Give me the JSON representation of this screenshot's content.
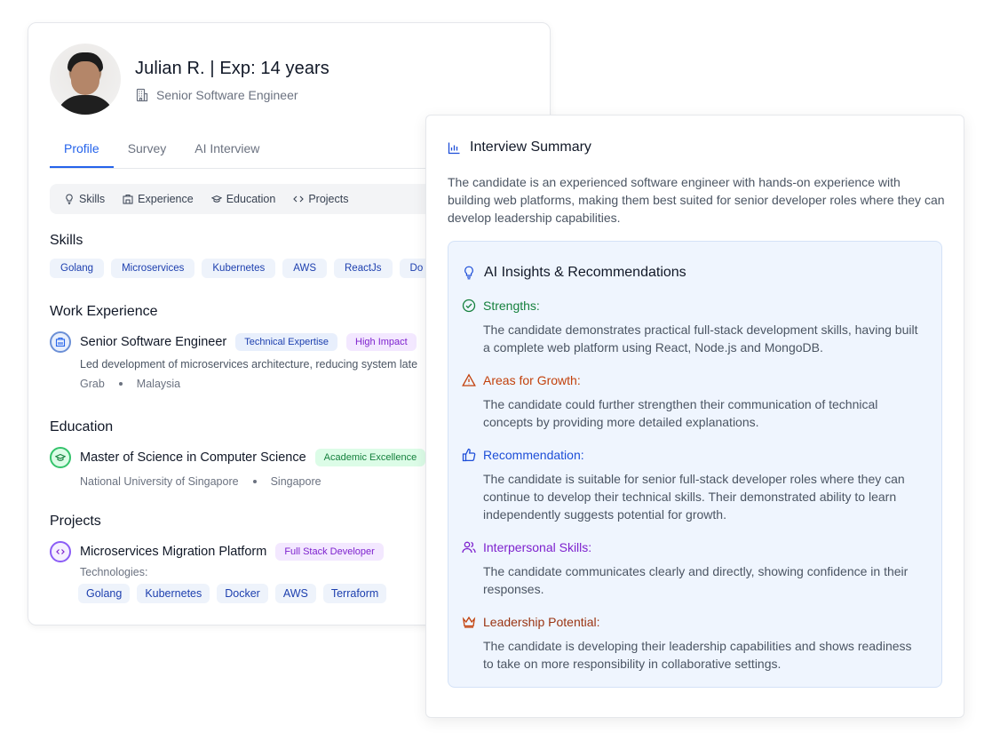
{
  "profile": {
    "name": "Julian R. | Exp: 14 years",
    "role": "Senior Software Engineer",
    "tabs": [
      {
        "label": "Profile",
        "active": true
      },
      {
        "label": "Survey",
        "active": false
      },
      {
        "label": "AI Interview",
        "active": false
      }
    ],
    "subnav": [
      {
        "label": "Skills",
        "icon": "lightbulb-icon"
      },
      {
        "label": "Experience",
        "icon": "building-icon"
      },
      {
        "label": "Education",
        "icon": "graduation-cap-icon"
      },
      {
        "label": "Projects",
        "icon": "code-icon"
      }
    ],
    "skills": {
      "title": "Skills",
      "items": [
        "Golang",
        "Microservices",
        "Kubernetes",
        "AWS",
        "ReactJs",
        "Do"
      ]
    },
    "work": {
      "title": "Work Experience",
      "entry_title": "Senior Software Engineer",
      "badges": [
        "Technical Expertise",
        "High Impact"
      ],
      "description": "Led development of microservices architecture, reducing system late",
      "company": "Grab",
      "location": "Malaysia"
    },
    "education": {
      "title": "Education",
      "entry_title": "Master of Science in Computer Science",
      "badge": "Academic Excellence",
      "school": "National University of Singapore",
      "location": "Singapore"
    },
    "projects": {
      "title": "Projects",
      "entry_title": "Microservices Migration Platform",
      "badge": "Full Stack Developer",
      "tech_label": "Technologies:",
      "technologies": [
        "Golang",
        "Kubernetes",
        "Docker",
        "AWS",
        "Terraform"
      ]
    }
  },
  "summary": {
    "title": "Interview Summary",
    "text": "The candidate is an experienced software engineer with hands-on experience with building web platforms, making them best suited for senior developer roles where they can develop leadership capabilities.",
    "insights_title": "AI Insights & Recommendations",
    "insights": [
      {
        "label": "Strengths:",
        "color": "#15803d",
        "icon": "check-circle-icon",
        "text": "The candidate demonstrates practical full-stack development skills, having built a complete web platform using React, Node.js and MongoDB."
      },
      {
        "label": "Areas for Growth:",
        "color": "#c2410c",
        "icon": "warning-triangle-icon",
        "text": "The candidate could further strengthen their communication of technical concepts by providing more detailed explanations."
      },
      {
        "label": "Recommendation:",
        "color": "#1d4ed8",
        "icon": "thumbs-up-icon",
        "text": "The candidate is suitable for senior full-stack developer roles where they can continue to develop their technical skills. Their demonstrated ability to learn independently suggests potential for growth."
      },
      {
        "label": "Interpersonal Skills:",
        "color": "#7e22ce",
        "icon": "users-icon",
        "text": "The candidate communicates clearly and directly, showing confidence in their responses."
      },
      {
        "label": "Leadership Potential:",
        "color": "#9a3412",
        "icon": "crown-icon",
        "text": "The candidate is developing their leadership capabilities and shows readiness to take on more responsibility in collaborative settings."
      }
    ]
  }
}
